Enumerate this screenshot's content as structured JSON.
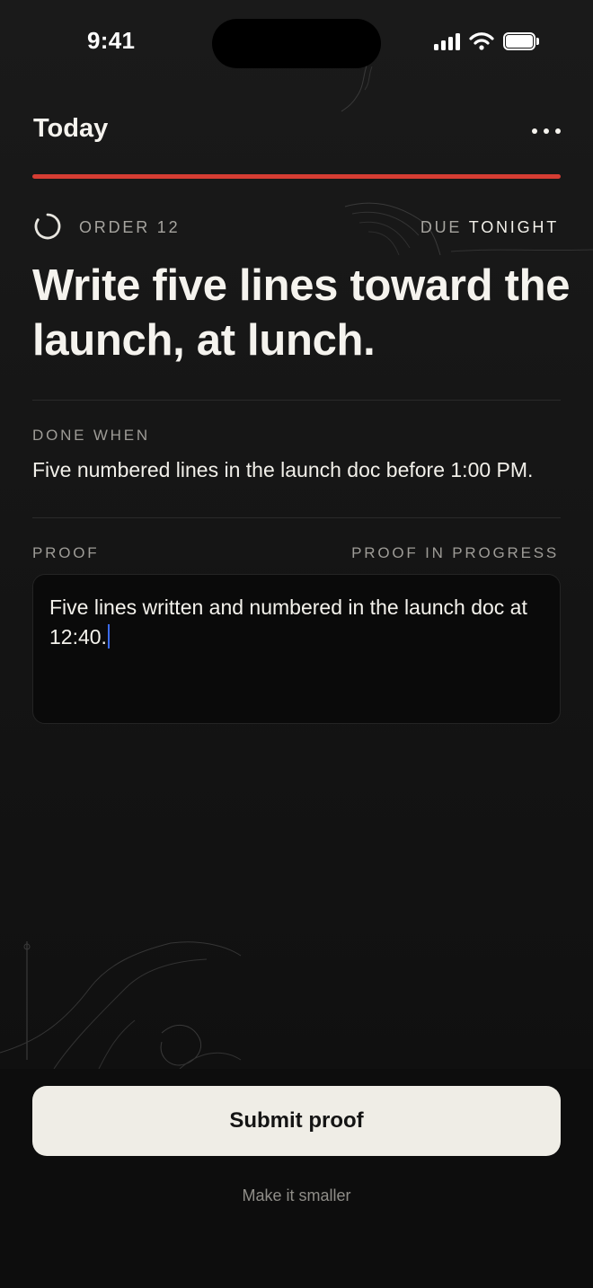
{
  "status_bar": {
    "time": "9:41",
    "icons": [
      "cellular-signal-icon",
      "wifi-icon",
      "battery-icon"
    ]
  },
  "header": {
    "title": "Today",
    "menu_icon": "more-horizontal-icon"
  },
  "colors": {
    "accent": "#d63d33",
    "background": "#131313",
    "text": "#f2f0ea",
    "muted": "#a6a49f",
    "button_bg": "#efede6",
    "caret": "#3b6cf2"
  },
  "task": {
    "status_icon": "progress-ring-icon",
    "order_label": "ORDER 12",
    "due_prefix": "DUE",
    "due_value": "TONIGHT",
    "title": "Write five lines toward the launch, at lunch."
  },
  "done_when": {
    "label": "DONE WHEN",
    "text": "Five numbered lines in the launch doc before 1:00 PM."
  },
  "proof": {
    "label": "Proof",
    "status": "Proof in progress",
    "value": "Five lines written and numbered in the launch doc at 12:40."
  },
  "actions": {
    "submit_label": "Submit proof",
    "smaller_label": "Make it smaller"
  }
}
